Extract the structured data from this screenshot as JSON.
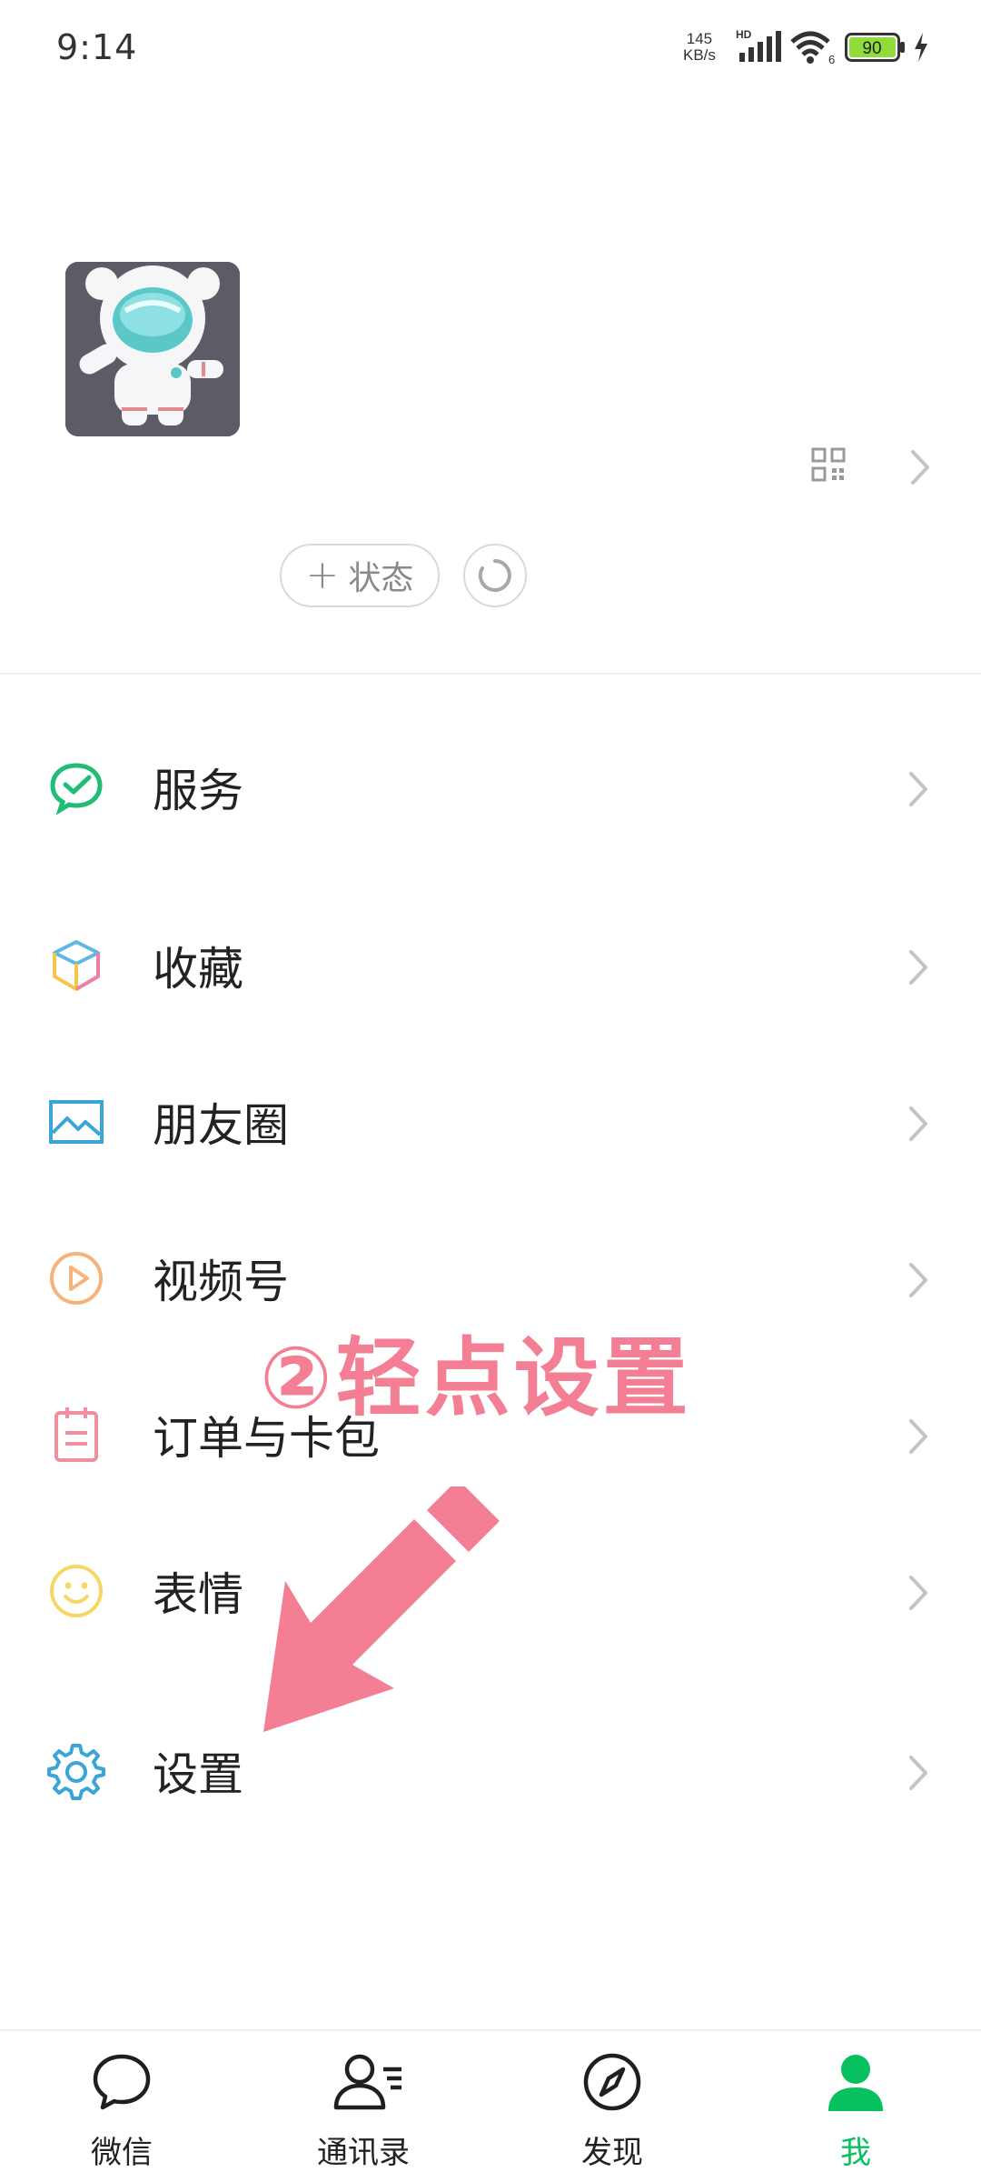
{
  "status_bar": {
    "time": "9:14",
    "net_speed_value": "145",
    "net_speed_unit": "KB/s",
    "network_type": "HD",
    "wifi_channel": "6",
    "battery": "90"
  },
  "profile": {
    "status_button_label": "状态"
  },
  "menu": [
    {
      "label": "服务",
      "icon": "wechat-pay-icon"
    },
    {
      "label": "收藏",
      "icon": "cube-icon"
    },
    {
      "label": "朋友圈",
      "icon": "image-icon"
    },
    {
      "label": "视频号",
      "icon": "play-circle-icon"
    },
    {
      "label": "订单与卡包",
      "icon": "notepad-icon"
    },
    {
      "label": "表情",
      "icon": "smiley-icon"
    },
    {
      "label": "设置",
      "icon": "gear-icon"
    }
  ],
  "annotation": {
    "text": "②轻点设置"
  },
  "bottom_nav": [
    {
      "label": "微信",
      "icon": "chat-bubble-icon",
      "active": false
    },
    {
      "label": "通讯录",
      "icon": "contacts-icon",
      "active": false
    },
    {
      "label": "发现",
      "icon": "compass-icon",
      "active": false
    },
    {
      "label": "我",
      "icon": "person-icon",
      "active": true
    }
  ],
  "colors": {
    "accent_green": "#07c160",
    "annotation_pink": "#f47e94",
    "battery_fill": "#8fdc3a"
  }
}
